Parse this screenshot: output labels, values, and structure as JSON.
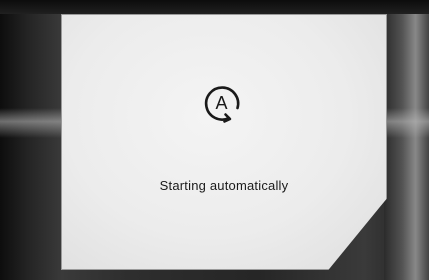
{
  "screen": {
    "icon": "auto-start-icon",
    "icon_letter": "A",
    "status_text": "Starting automatically"
  },
  "colors": {
    "screen_bg": "#ececec",
    "text": "#1a1a1a",
    "bezel": "#2a2a2a"
  }
}
